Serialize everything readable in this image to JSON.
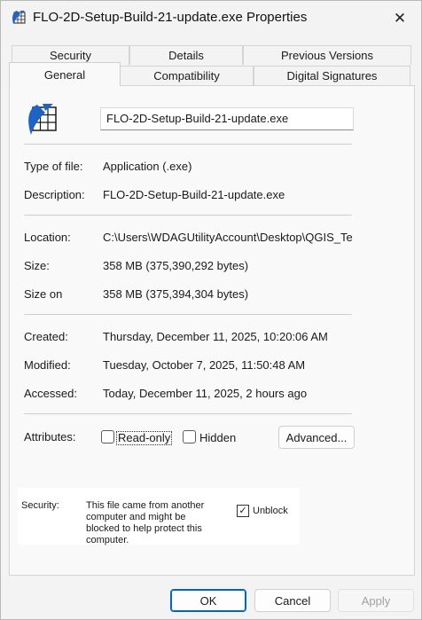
{
  "window": {
    "title": "FLO-2D-Setup-Build-21-update.exe Properties",
    "close_glyph": "✕"
  },
  "tabs": {
    "row1": [
      "Security",
      "Details",
      "Previous Versions"
    ],
    "row2": [
      "General",
      "Compatibility",
      "Digital Signatures"
    ],
    "active": "General"
  },
  "general": {
    "file_name": "FLO-2D-Setup-Build-21-update.exe",
    "file_icon": "flo2d-app-icon",
    "type_label": "Type of file:",
    "type_value": "Application (.exe)",
    "description_label": "Description:",
    "description_value": "FLO-2D-Setup-Build-21-update.exe",
    "location_label": "Location:",
    "location_value": "C:\\Users\\WDAGUtilityAccount\\Desktop\\QGIS_Te",
    "size_label": "Size:",
    "size_value": "358 MB (375,390,292 bytes)",
    "size_on_label": "Size on",
    "size_on_value": "358 MB (375,394,304 bytes)",
    "created_label": "Created:",
    "created_value": "Thursday, December 11, 2025, 10:20:06 AM",
    "modified_label": "Modified:",
    "modified_value": "Tuesday, October 7, 2025, 11:50:48 AM",
    "accessed_label": "Accessed:",
    "accessed_value": "Today, December 11, 2025, 2 hours ago",
    "attributes_label": "Attributes:",
    "readonly_label": "Read-only",
    "readonly_checked": false,
    "hidden_label": "Hidden",
    "hidden_checked": false,
    "advanced_label": "Advanced..."
  },
  "security": {
    "label": "Security:",
    "message": "This file came from another computer and might be blocked to help protect this computer.",
    "unblock_label": "Unblock",
    "unblock_checked": true,
    "check_glyph": "✓"
  },
  "buttons": {
    "ok": "OK",
    "cancel": "Cancel",
    "apply": "Apply"
  },
  "colors": {
    "ok_border": "#0067c0",
    "apply_disabled_text": "#a0a0a0"
  }
}
